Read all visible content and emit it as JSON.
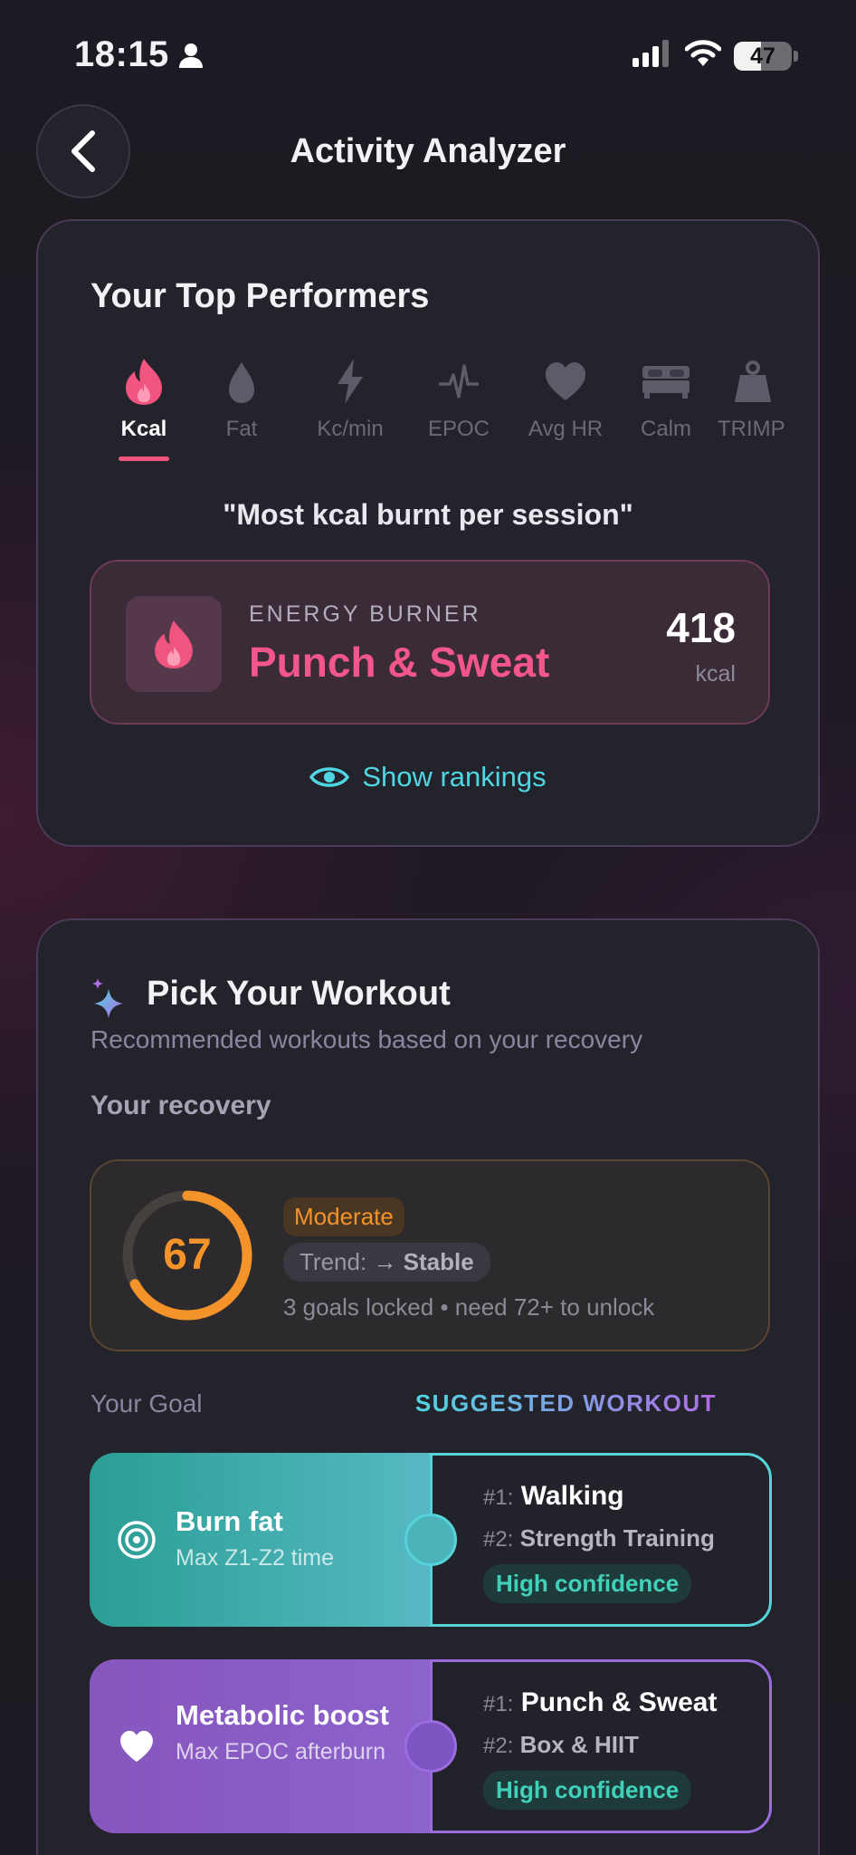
{
  "status_bar": {
    "time": "18:15",
    "battery": "47",
    "battery_level": 0.47
  },
  "header": {
    "title": "Activity Analyzer"
  },
  "top_performers": {
    "title": "Your Top Performers",
    "tabs": [
      {
        "label": "Kcal",
        "icon": "flame-icon",
        "active": true
      },
      {
        "label": "Fat",
        "icon": "drop-icon",
        "active": false
      },
      {
        "label": "Kc/min",
        "icon": "bolt-icon",
        "active": false
      },
      {
        "label": "EPOC",
        "icon": "pulse-icon",
        "active": false
      },
      {
        "label": "Avg HR",
        "icon": "heart-icon",
        "active": false
      },
      {
        "label": "Calm",
        "icon": "bed-icon",
        "active": false
      },
      {
        "label": "TRIMP",
        "icon": "weight-icon",
        "active": false
      }
    ],
    "quote": "\"Most kcal burnt per session\"",
    "winner": {
      "eyebrow": "ENERGY BURNER",
      "name": "Punch & Sweat",
      "value": "418",
      "unit": "kcal"
    },
    "show_rankings": "Show rankings"
  },
  "pick_workout": {
    "title": "Pick Your Workout",
    "subtitle": "Recommended workouts based on your recovery",
    "recovery_label": "Your recovery",
    "recovery": {
      "score": "67",
      "score_fraction": 0.67,
      "level": "Moderate",
      "trend_label": "Trend:",
      "trend_value": "→ Stable",
      "note": "3 goals locked • need 72+ to unlock"
    },
    "goal_header": "Your Goal",
    "suggested_header": "SUGGESTED WORKOUT",
    "goals": [
      {
        "name": "Burn fat",
        "desc": "Max Z1-Z2 time",
        "pick1": "Walking",
        "pick2": "Strength Training",
        "confidence": "High confidence"
      },
      {
        "name": "Metabolic boost",
        "desc": "Max EPOC afterburn",
        "pick1": "Punch & Sweat",
        "pick2": "Box & HIIT",
        "confidence": "High confidence"
      }
    ],
    "rank1_prefix": "#1:",
    "rank2_prefix": "#2:"
  },
  "colors": {
    "accent_pink": "#f2568b",
    "accent_cyan": "#4fd6e2",
    "recovery_orange": "#f3932a",
    "confidence_green": "#3fd1b9"
  }
}
